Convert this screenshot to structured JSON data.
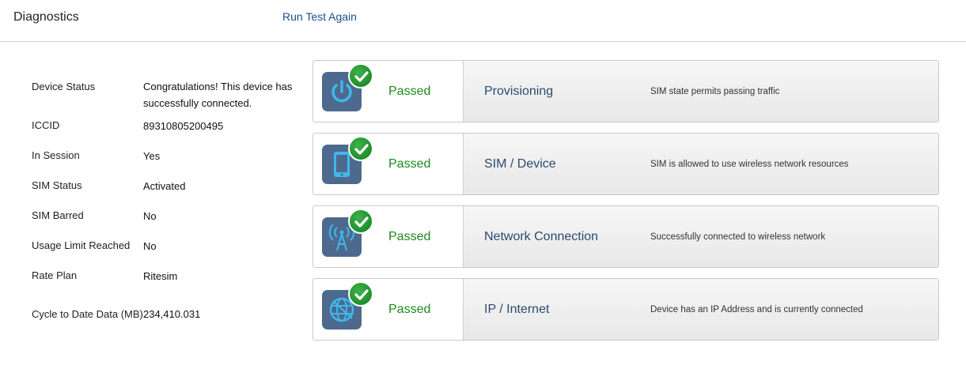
{
  "header": {
    "title": "Diagnostics",
    "run_test_label": "Run Test Again"
  },
  "device_info": [
    {
      "label": "Device Status",
      "value": "Congratulations! This device has successfully connected."
    },
    {
      "label": "ICCID",
      "value": "89310805200495"
    },
    {
      "label": "In Session",
      "value": "Yes"
    },
    {
      "label": "SIM Status",
      "value": "Activated"
    },
    {
      "label": "SIM Barred",
      "value": "No"
    },
    {
      "label": "Usage Limit Reached",
      "value": "No"
    },
    {
      "label": "Rate Plan",
      "value": "Ritesim"
    },
    {
      "label": "Cycle to Date Data (MB)",
      "value": "234,410.031"
    }
  ],
  "tests": [
    {
      "icon": "power-icon",
      "status": "Passed",
      "name": "Provisioning",
      "description": "SIM state permits passing traffic"
    },
    {
      "icon": "phone-icon",
      "status": "Passed",
      "name": "SIM / Device",
      "description": "SIM is allowed to use wireless network resources"
    },
    {
      "icon": "antenna-icon",
      "status": "Passed",
      "name": "Network Connection",
      "description": "Successfully connected to wireless network"
    },
    {
      "icon": "globe-icon",
      "status": "Passed",
      "name": "IP / Internet",
      "description": "Device has an IP Address and is currently connected"
    }
  ],
  "colors": {
    "passed": "#1c8a1c",
    "link": "#1d4e89",
    "icon_bg": "#4d6a8e",
    "icon_accent": "#3fb8ec"
  }
}
